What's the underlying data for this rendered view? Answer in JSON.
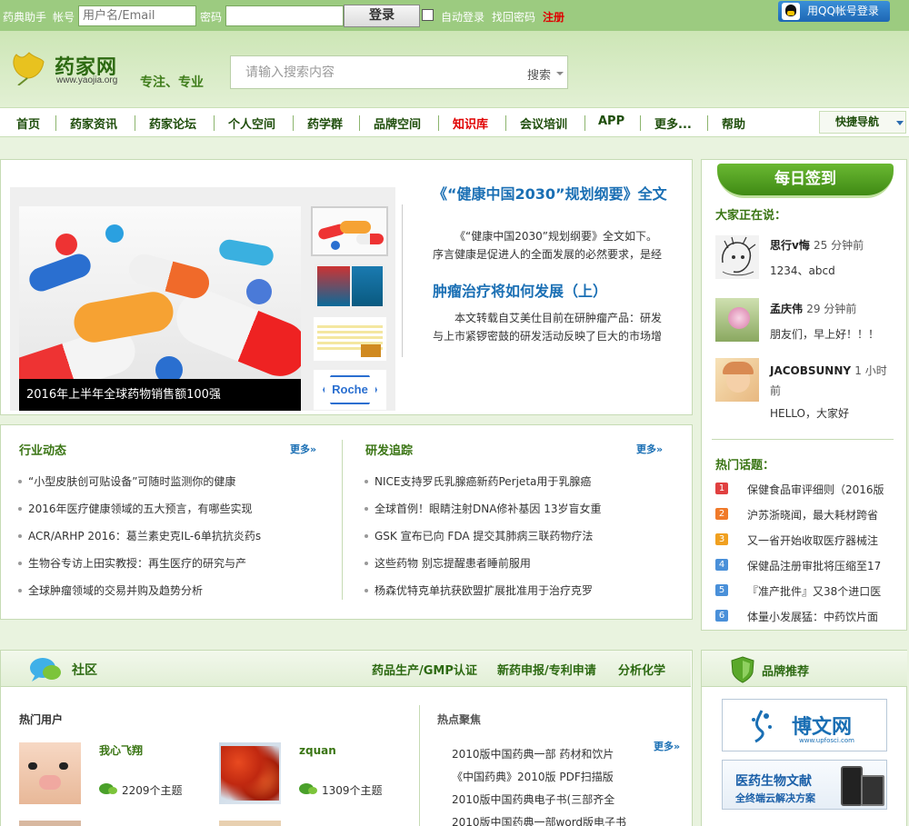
{
  "topbar": {
    "brand": "药典助手",
    "account_label": "帐号",
    "account_placeholder": "用户名/Email",
    "password_label": "密码",
    "login_button": "登录",
    "auto_login": "自动登录",
    "find_password": "找回密码",
    "register": "注册",
    "qq_login": "用QQ帐号登录"
  },
  "header": {
    "logo_name": "药家网",
    "logo_url": "www.yaojia.org",
    "slogan": "专注、专业",
    "search_placeholder": "请输入搜索内容",
    "search_button": "搜索"
  },
  "nav": {
    "items": [
      "首页",
      "药家资讯",
      "药家论坛",
      "个人空间",
      "药学群",
      "品牌空间",
      "知识库",
      "会议培训",
      "APP",
      "更多...",
      "帮助"
    ],
    "quick": "快捷导航"
  },
  "featured": {
    "caption": "2016年上半年全球药物销售额100强",
    "articles": [
      {
        "title": "《“健康中国2030”规划纲要》全文",
        "desc": "《“健康中国2030”规划纲要》全文如下。序言健康是促进人的全面发展的必然要求，是经"
      },
      {
        "title": "肿瘤治疗将如何发展（上）",
        "desc": "本文转载自艾美仕目前在研肿瘤产品：研发与上市紧锣密鼓的研发活动反映了巨大的市场增"
      }
    ],
    "thumb_roche": "Roche"
  },
  "news": {
    "more": "更多»",
    "industry": {
      "title": "行业动态",
      "items": [
        "“小型皮肤创可贴设备”可随时监测你的健康",
        "2016年医疗健康领域的五大预言，有哪些实现",
        "ACR/ARHP 2016：葛兰素史克IL-6单抗抗炎药s",
        "生物谷专访上田实教授：再生医疗的研究与产",
        "全球肿瘤领域的交易并购及趋势分析"
      ]
    },
    "rnd": {
      "title": "研发追踪",
      "items": [
        "NICE支持罗氏乳腺癌新药Perjeta用于乳腺癌",
        "全球首例！眼睛注射DNA修补基因 13岁盲女重",
        "GSK 宣布已向 FDA 提交其肺病三联药物疗法",
        "这些药物 别忘提醒患者睡前服用",
        "杨森优特克单抗获欧盟扩展批准用于治疗克罗"
      ]
    }
  },
  "sidebar": {
    "sign_in": "每日签到",
    "talking_title": "大家正在说：",
    "posts": [
      {
        "name": "思行v悔",
        "time": "25 分钟前",
        "msg": "1234、abcd"
      },
      {
        "name": "孟庆伟",
        "time": "29 分钟前",
        "msg": "朋友们，早上好！！！"
      },
      {
        "name": "JACOBSUNNY",
        "time": "1 小时前",
        "msg": "HELLO，大家好"
      }
    ],
    "hot_title": "热门话题：",
    "topics": [
      {
        "rank": "1",
        "text": "保健食品审评细则（2016版",
        "color": "#e04040"
      },
      {
        "rank": "2",
        "text": "沪苏浙晓闻，最大耗材跨省",
        "color": "#f07a2a"
      },
      {
        "rank": "3",
        "text": "又一省开始收取医疗器械注",
        "color": "#f0a020"
      },
      {
        "rank": "4",
        "text": "保健品注册审批将压缩至17",
        "color": "#4a90d9"
      },
      {
        "rank": "5",
        "text": "『准产批件』又38个进口医",
        "color": "#4a90d9"
      },
      {
        "rank": "6",
        "text": "体量小发展猛：中药饮片面",
        "color": "#4a90d9"
      }
    ]
  },
  "community": {
    "title": "社区",
    "links": [
      "药品生产/GMP认证",
      "新药申报/专利申请",
      "分析化学"
    ],
    "hot_users_title": "热门用户",
    "users": [
      {
        "name": "我心飞翔",
        "count": "2209个主题"
      },
      {
        "name": "zquan",
        "count": "1309个主题"
      }
    ],
    "hot_focus_title": "热点聚焦",
    "more": "更多»",
    "focus": [
      "2010版中国药典一部 药材和饮片",
      "《中国药典》2010版 PDF扫描版",
      "2010版中国药典电子书(三部齐全",
      "2010版中国药典一部word版电子书"
    ]
  },
  "brand": {
    "title": "品牌推荐",
    "bowen": "博文网",
    "bowen_url": "www.upfosci.com",
    "med_title": "医药生物文献",
    "med_sub": "全终端云解决方案"
  },
  "colors": {
    "topbar": "#9ccb80",
    "accent_green": "#3a7514",
    "link_blue": "#1a6fb4",
    "hot_red": "#e00000"
  }
}
